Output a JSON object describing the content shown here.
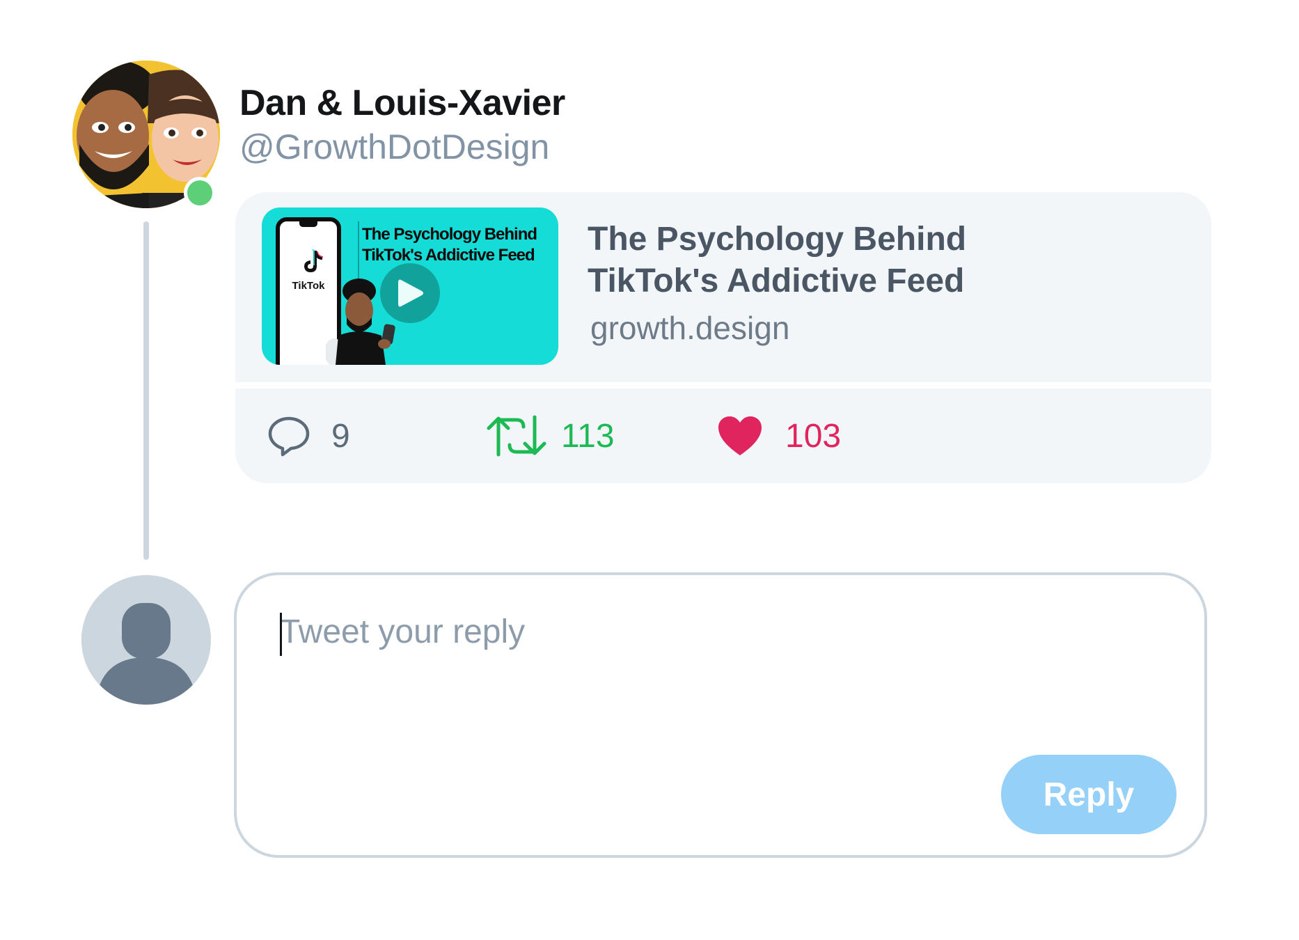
{
  "author": {
    "name": "Dan & Louis-Xavier",
    "handle": "@GrowthDotDesign",
    "avatar_icon": "cartoon-duo-avatar",
    "online": true
  },
  "tweet": {
    "link_preview": {
      "thumbnail": {
        "title": "The Psychology Behind TikTok's Addictive Feed",
        "phone_logo_text": "TikTok",
        "play_icon": "play-icon"
      },
      "title": "The Psychology Behind TikTok's Addictive Feed",
      "domain": "growth.design"
    },
    "actions": {
      "replies": "9",
      "retweets": "113",
      "likes": "103"
    }
  },
  "reply": {
    "placeholder": "Tweet your reply",
    "value": "",
    "button_label": "Reply"
  },
  "colors": {
    "retweet": "#1db954",
    "like": "#e0245e",
    "reply_button": "#94d0f8",
    "online": "#5ccf78",
    "thumbnail_bg": "#16dcd7"
  }
}
